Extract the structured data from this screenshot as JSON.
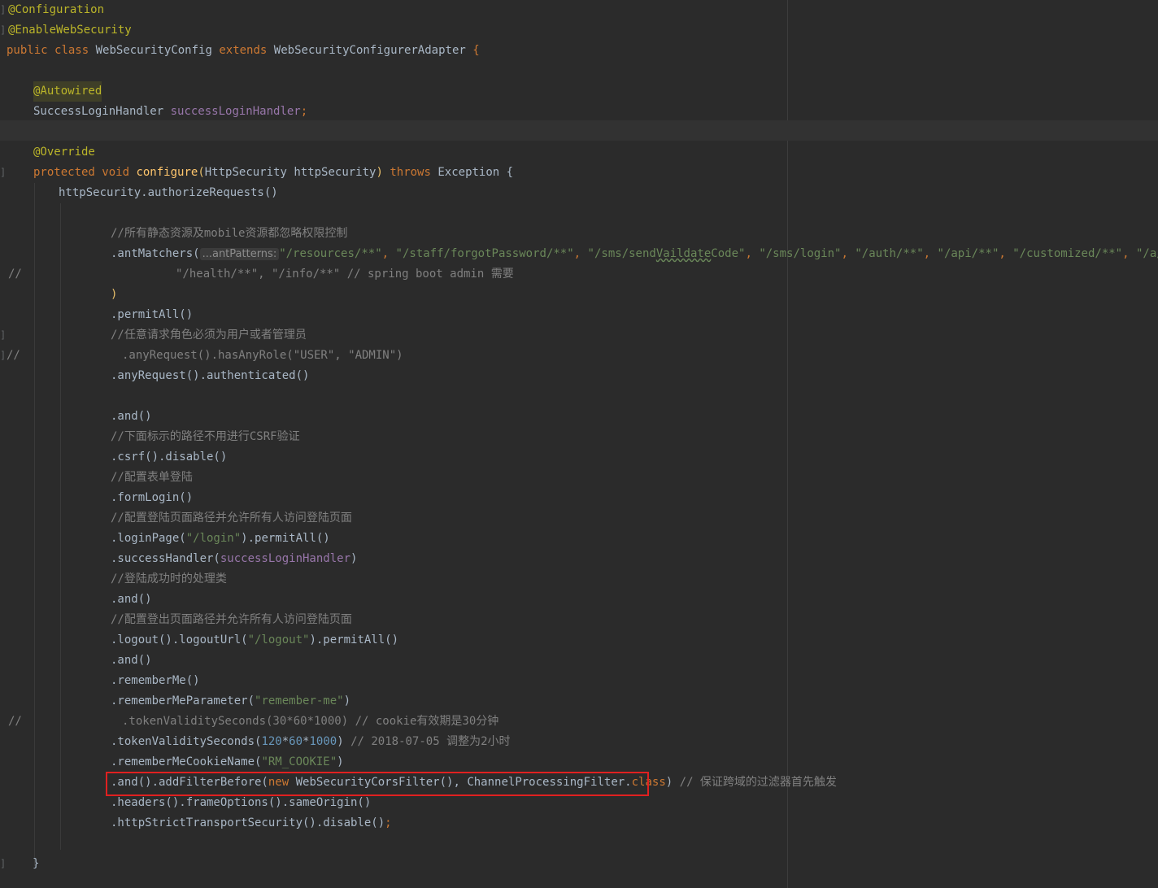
{
  "editor": {
    "annotations": {
      "configuration": "@Configuration",
      "enable_web_security": "@EnableWebSecurity",
      "autowired": "@Autowired",
      "override": "@Override"
    },
    "class_decl": {
      "kw_public": "public",
      "kw_class": "class",
      "name": "WebSecurityConfig",
      "kw_extends": "extends",
      "parent": "WebSecurityConfigurerAdapter",
      "brace": "{"
    },
    "field_decl": {
      "type": "SuccessLoginHandler",
      "name": "successLoginHandler",
      "semi": ";"
    },
    "method_decl": {
      "kw_protected": "protected",
      "kw_void": "void",
      "name": "configure",
      "open": "(",
      "param": "HttpSecurity httpSecurity",
      "close": ")",
      "kw_throws": "throws",
      "exception": "Exception {"
    },
    "lines": {
      "authorize": "httpSecurity.authorizeRequests()",
      "cmt_static": "//所有静态资源及mobile资源都忽略权限控制",
      "ant_prefix": ".antMatchers(",
      "ant_hint": "...antPatterns:",
      "ant_str1": "\"/resources/**\"",
      "ant_str2": "\"/staff/forgotPassword/**\"",
      "ant_str3a": "\"/sms/send",
      "ant_str3b": "Vaildate",
      "ant_str3c": "Code\"",
      "ant_str4": "\"/sms/login\"",
      "ant_str5": "\"/auth/**\"",
      "ant_str6": "\"/api/**\"",
      "ant_str7": "\"/customized/**\"",
      "ant_str8": "\"/a/*\"",
      "comma": ",",
      "health_cmt_prefix": "//",
      "health_cmt_body": "\"/health/**\", \"/info/**\" // spring boot admin 需要",
      "close_paren": ")",
      "permit_all": ".permitAll()",
      "cmt_role": "//任意请求角色必须为用户或者管理员",
      "role_cmt_prefix": "//",
      "role_cmt_body": ".anyRequest().hasAnyRole(\"USER\", \"ADMIN\")",
      "any_request": ".anyRequest().authenticated()",
      "and1": ".and()",
      "cmt_csrf": "//下面标示的路径不用进行CSRF验证",
      "csrf": ".csrf().disable()",
      "cmt_form": "//配置表单登陆",
      "form_login": ".formLogin()",
      "cmt_login_page": "//配置登陆页面路径并允许所有人访问登陆页面",
      "login_page_prefix": ".loginPage(",
      "login_page_str": "\"/login\"",
      "login_page_suffix": ").permitAll()",
      "success_prefix": ".successHandler(",
      "success_field": "successLoginHandler",
      "success_suffix": ")",
      "cmt_success": "//登陆成功时的处理类",
      "and2": ".and()",
      "cmt_logout": "//配置登出页面路径并允许所有人访问登陆页面",
      "logout_prefix": ".logout().logoutUrl(",
      "logout_str": "\"/logout\"",
      "logout_suffix": ").permitAll()",
      "and3": ".and()",
      "remember_me": ".rememberMe()",
      "remember_param_prefix": ".rememberMeParameter(",
      "remember_param_str": "\"remember-me\"",
      "remember_param_suffix": ")",
      "token_cmt_prefix": "//",
      "token_cmt_body": ".tokenValiditySeconds(30*60*1000) // cookie有效期是30分钟",
      "token_prefix": ".tokenValiditySeconds(",
      "token_n1": "120",
      "token_op1": "*",
      "token_n2": "60",
      "token_op2": "*",
      "token_n3": "1000",
      "token_suffix": ")",
      "token_cmt": "// 2018-07-05 调整为2小时",
      "cookie_prefix": ".rememberMeCookieName(",
      "cookie_str": "\"RM_COOKIE\"",
      "cookie_suffix": ")",
      "filter_prefix": ".and().addFilterBefore(",
      "filter_new": "new",
      "filter_mid": " WebSecurityCorsFilter(), ChannelProcessingFilter.",
      "filter_class": "class",
      "filter_suffix": ")",
      "filter_cmt": "// 保证跨域的过滤器首先触发",
      "headers": ".headers().frameOptions().sameOrigin()",
      "hsts": ".httpStrictTransportSecurity().disable()",
      "hsts_semi": ";",
      "method_close": "}"
    }
  }
}
